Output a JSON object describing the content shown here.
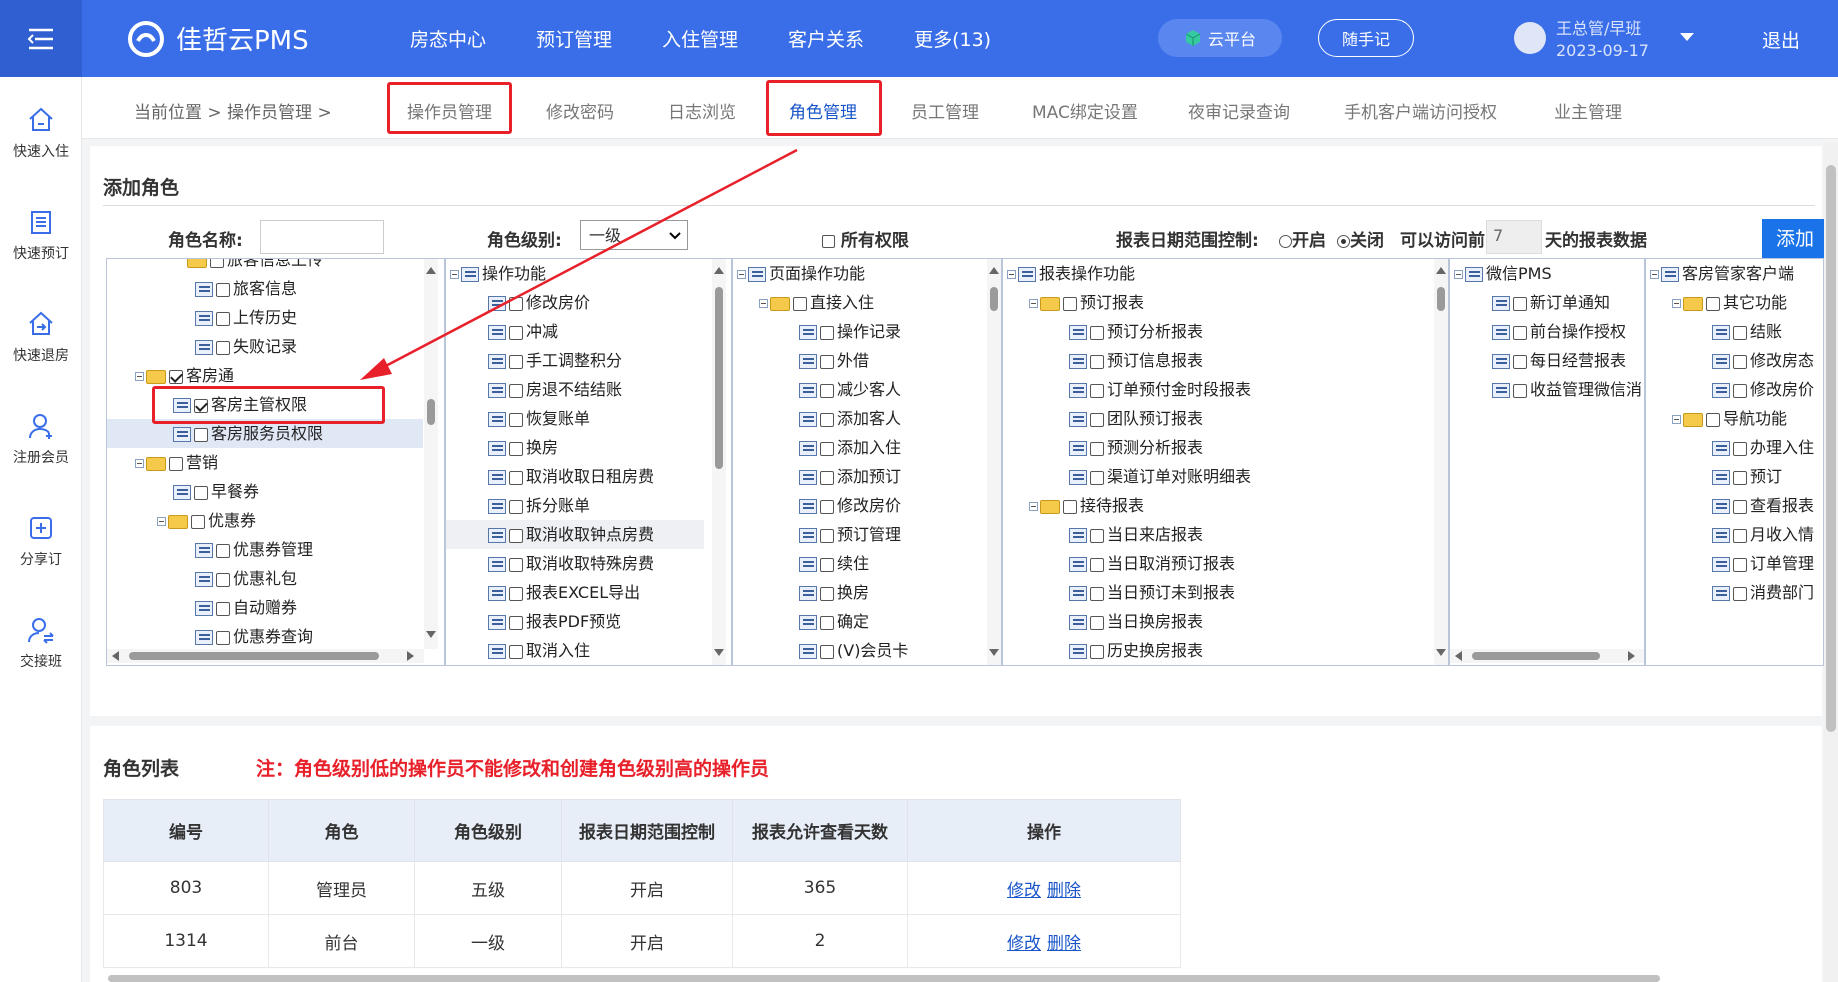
{
  "header": {
    "brand": "佳哲云PMS",
    "nav": [
      "房态中心",
      "预订管理",
      "入住管理",
      "客户关系",
      "更多(13)"
    ],
    "cloud_label": "云平台",
    "note_label": "随手记",
    "user_name": "王总管/早班",
    "user_date": "2023-09-17",
    "logout": "退出"
  },
  "sidebar": [
    {
      "label": "快速入住",
      "icon": "home-icon"
    },
    {
      "label": "快速预订",
      "icon": "clipboard-icon"
    },
    {
      "label": "快速退房",
      "icon": "checkout-icon"
    },
    {
      "label": "注册会员",
      "icon": "user-add-icon"
    },
    {
      "label": "分享订",
      "icon": "share-icon"
    },
    {
      "label": "交接班",
      "icon": "handover-icon"
    }
  ],
  "breadcrumb": "当前位置 > 操作员管理 >",
  "tabs": [
    "操作员管理",
    "修改密码",
    "日志浏览",
    "角色管理",
    "员工管理",
    "MAC绑定设置",
    "夜审记录查询",
    "手机客户端访问授权",
    "业主管理"
  ],
  "add_role": {
    "title": "添加角色",
    "name_label": "角色名称:",
    "name_value": "",
    "level_label": "角色级别:",
    "level_value": "一级",
    "all_perm_label": "所有权限",
    "date_ctrl_label": "报表日期范围控制:",
    "opt_on": "开启",
    "opt_off": "关闭",
    "access_prefix": "可以访问前",
    "access_days": "7",
    "access_suffix": "天的报表数据",
    "add_button": "添加"
  },
  "trees": {
    "t1": [
      "旅客信息上传",
      "旅客信息",
      "上传历史",
      "失败记录",
      "客房通",
      "客房主管权限",
      "客房服务员权限",
      "营销",
      "早餐券",
      "优惠券",
      "优惠券管理",
      "优惠礼包",
      "自动赠券",
      "优惠券查询"
    ],
    "t2": [
      "操作功能",
      "修改房价",
      "冲减",
      "手工调整积分",
      "房退不结结账",
      "恢复账单",
      "换房",
      "取消收取日租房费",
      "拆分账单",
      "取消收取钟点房费",
      "取消收取特殊房费",
      "报表EXCEL导出",
      "报表PDF预览",
      "取消入住"
    ],
    "t3": [
      "页面操作功能",
      "直接入住",
      "操作记录",
      "外借",
      "减少客人",
      "添加客人",
      "添加入住",
      "添加预订",
      "修改房价",
      "预订管理",
      "续住",
      "换房",
      "确定",
      "(V)会员卡"
    ],
    "t4": [
      "报表操作功能",
      "预订报表",
      "预订分析报表",
      "预订信息报表",
      "订单预付金时段报表",
      "团队预订报表",
      "预测分析报表",
      "渠道订单对账明细表",
      "接待报表",
      "当日来店报表",
      "当日取消预订报表",
      "当日预订未到报表",
      "当日换房报表",
      "历史换房报表"
    ],
    "t5": [
      "微信PMS",
      "新订单通知",
      "前台操作授权",
      "每日经营报表",
      "收益管理微信消"
    ],
    "t6": [
      "客房管家客户端",
      "其它功能",
      "结账",
      "修改房态",
      "修改房价",
      "导航功能",
      "办理入住",
      "预订",
      "查看报表",
      "月收入情",
      "订单管理",
      "消费部门"
    ]
  },
  "role_list": {
    "title": "角色列表",
    "note": "注：角色级别低的操作员不能修改和创建角色级别高的操作员",
    "columns": [
      "编号",
      "角色",
      "角色级别",
      "报表日期范围控制",
      "报表允许查看天数",
      "操作"
    ],
    "rows": [
      {
        "id": "803",
        "role": "管理员",
        "level": "五级",
        "ctrl": "开启",
        "days": "365",
        "edit": "修改",
        "del": "删除"
      },
      {
        "id": "1314",
        "role": "前台",
        "level": "一级",
        "ctrl": "开启",
        "days": "2",
        "edit": "修改",
        "del": "删除"
      }
    ]
  }
}
